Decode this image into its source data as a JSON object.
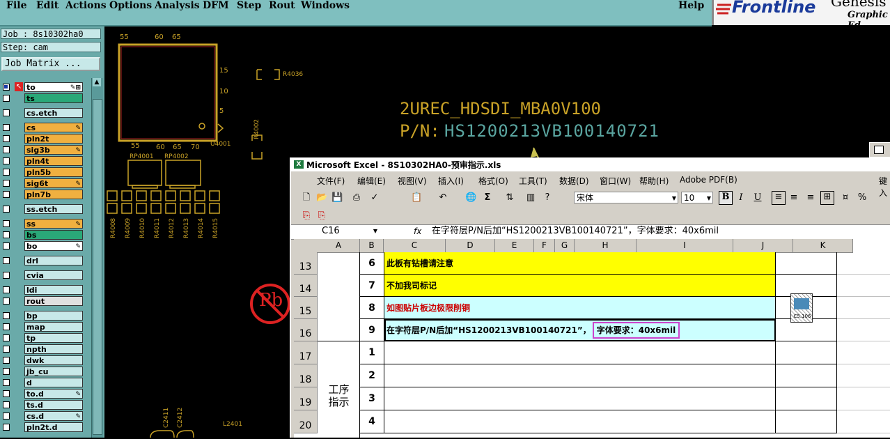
{
  "menubar": {
    "file": "File",
    "edit": "Edit",
    "actions": "Actions",
    "options": "Options",
    "analysis": "Analysis",
    "dfm": "DFM",
    "step": "Step",
    "rout": "Rout",
    "windows": "Windows",
    "help": "Help"
  },
  "logo": {
    "main": "Frontline",
    "genesis": "Genesis",
    "sub": "Graphic Ed"
  },
  "job": {
    "job_label": "Job : 8s10302ha0",
    "step_label": "Step: cam",
    "matrix_button": "Job Matrix ..."
  },
  "layers": [
    {
      "name": "to",
      "color": "#ffffff",
      "mark": "✎⊞"
    },
    {
      "name": "ts",
      "color": "#2aa878",
      "mark": ""
    },
    {
      "name": "cs.etch",
      "color": "#c7e8e8",
      "mark": ""
    },
    {
      "name": "cs",
      "color": "#f0b040",
      "mark": "✎"
    },
    {
      "name": "pln2t",
      "color": "#f0b040",
      "mark": ""
    },
    {
      "name": "sig3b",
      "color": "#f0b040",
      "mark": "✎"
    },
    {
      "name": "pln4t",
      "color": "#f0b040",
      "mark": ""
    },
    {
      "name": "pln5b",
      "color": "#f0b040",
      "mark": ""
    },
    {
      "name": "sig6t",
      "color": "#f0b040",
      "mark": "✎"
    },
    {
      "name": "pln7b",
      "color": "#f0b040",
      "mark": ""
    },
    {
      "name": "ss.etch",
      "color": "#c7e8e8",
      "mark": ""
    },
    {
      "name": "ss",
      "color": "#f0b040",
      "mark": "✎"
    },
    {
      "name": "bs",
      "color": "#2aa878",
      "mark": ""
    },
    {
      "name": "bo",
      "color": "#ffffff",
      "mark": "✎"
    },
    {
      "name": "drl",
      "color": "#c7e8e8",
      "mark": ""
    },
    {
      "name": "cvia",
      "color": "#c7e8e8",
      "mark": ""
    },
    {
      "name": "ldi",
      "color": "#c7e8e8",
      "mark": ""
    },
    {
      "name": "rout",
      "color": "#e0e0e0",
      "mark": ""
    },
    {
      "name": "bp",
      "color": "#c7e8e8",
      "mark": ""
    },
    {
      "name": "map",
      "color": "#c7e8e8",
      "mark": ""
    },
    {
      "name": "tp",
      "color": "#c7e8e8",
      "mark": ""
    },
    {
      "name": "npth",
      "color": "#c7e8e8",
      "mark": ""
    },
    {
      "name": "dwk",
      "color": "#c7e8e8",
      "mark": ""
    },
    {
      "name": "jb_cu",
      "color": "#c7e8e8",
      "mark": ""
    },
    {
      "name": "d",
      "color": "#c7e8e8",
      "mark": ""
    },
    {
      "name": "to.d",
      "color": "#c7e8e8",
      "mark": "✎"
    },
    {
      "name": "ts.d",
      "color": "#c7e8e8",
      "mark": ""
    },
    {
      "name": "cs.d",
      "color": "#c7e8e8",
      "mark": "✎"
    },
    {
      "name": "pln2t.d",
      "color": "#c7e8e8",
      "mark": ""
    }
  ],
  "pcb": {
    "board_name": "2UREC_HDSDI_MBA0V100",
    "pn_label": "P/N:",
    "pn_value": "HS1200213VB100140721",
    "refs": {
      "r4036": "R4036",
      "r4002": "R4002",
      "u4001": "U4001",
      "rp4001": "RP4001",
      "rp4002": "RP4002",
      "l2401": "L2401",
      "c2411": "C2411",
      "c2412": "C2412",
      "r4008": "R4008",
      "r4009": "R4009",
      "r4010": "R4010",
      "r4011": "R4011",
      "r4012": "R4012",
      "r4013": "R4013",
      "r4014": "R4014",
      "r4015": "R4015"
    },
    "pin_labels": {
      "p55": "55",
      "p60": "60",
      "p65": "65",
      "p70": "70",
      "p15": "15",
      "p10": "10",
      "p5": "5"
    },
    "pb_symbol": "Pb"
  },
  "excel": {
    "title": "Microsoft Excel - 8S10302HA0-预审指示.xls",
    "menu": [
      "文件(F)",
      "编辑(E)",
      "视图(V)",
      "插入(I)",
      "格式(O)",
      "工具(T)",
      "数据(D)",
      "窗口(W)",
      "帮助(H)",
      "Adobe PDF(B)"
    ],
    "menu_right": "键入",
    "font_name": "宋体",
    "font_size": "10",
    "bold": "B",
    "italic": "I",
    "underline": "U",
    "percent": "%",
    "name_box": "C16",
    "fx": "fx",
    "formula": "在字符层P/N后加“HS1200213VB100140721”，字体要求：40x6mil",
    "columns": [
      "A",
      "B",
      "C",
      "D",
      "E",
      "F",
      "G",
      "H",
      "I",
      "J",
      "K"
    ],
    "rows": [
      {
        "num": "13",
        "idx": "6",
        "text": "此板有钻槽请注意"
      },
      {
        "num": "14",
        "idx": "7",
        "text": "不加我司标记"
      },
      {
        "num": "15",
        "idx": "8",
        "text": "如图贴片板边极限削铜"
      },
      {
        "num": "16",
        "idx": "9",
        "text": "在字符层P/N后加“HS1200213VB100140721”，",
        "text2": "字体要求：40x6mil"
      },
      {
        "num": "17",
        "idx": "1",
        "text": ""
      },
      {
        "num": "18",
        "idx": "2",
        "text": ""
      },
      {
        "num": "19",
        "idx": "3",
        "text": ""
      },
      {
        "num": "20",
        "idx": "4",
        "text": ""
      }
    ],
    "section_label": "工序\n指示",
    "object_label": "C5.106"
  },
  "colors": {
    "menubar": "#7fbfbf",
    "panel": "#6aaaa9",
    "pcb_silk": "#c9a227",
    "pcb_text": "#5aa5a0",
    "yellow_row": "#ffff00",
    "cyan_row": "#ccffff",
    "highlight": "#cc44cc"
  }
}
